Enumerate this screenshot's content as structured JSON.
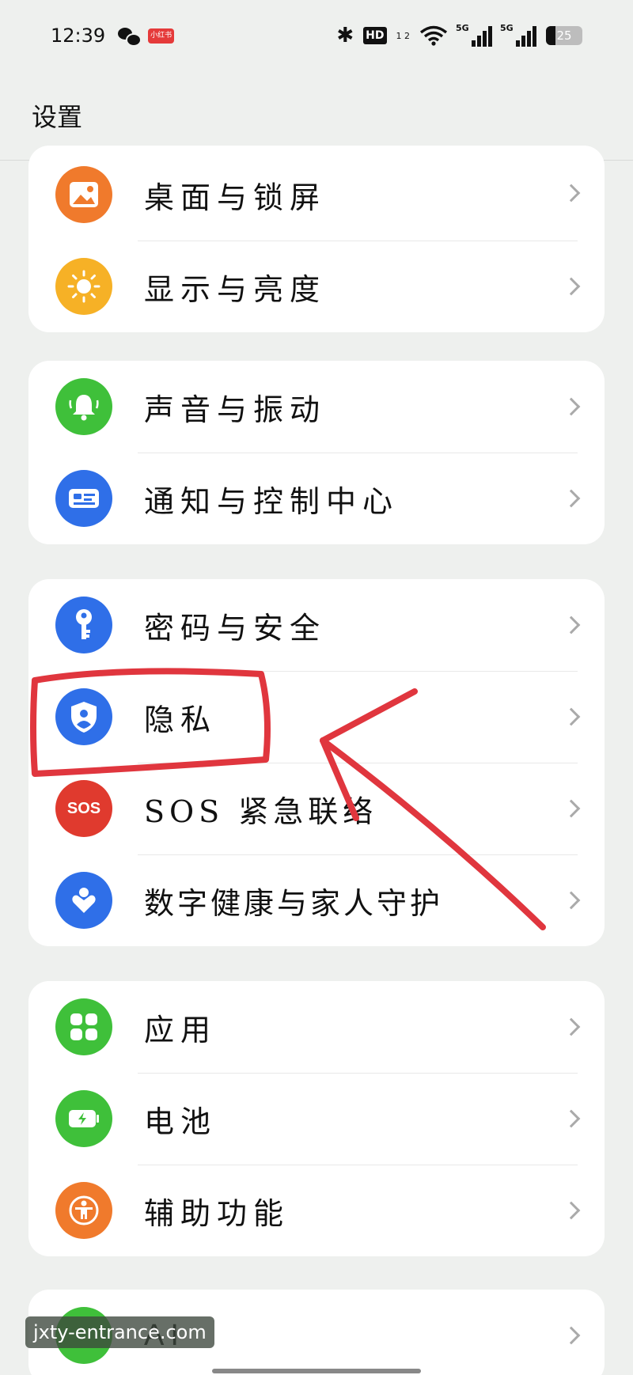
{
  "status_bar": {
    "time": "12:39",
    "xhs_badge": "小红书",
    "hd_badge": "HD",
    "hd_sup": "1 2",
    "signal1_tag": "5G",
    "signal2_tag": "5G",
    "battery_level": "25"
  },
  "header": {
    "title": "设置"
  },
  "cards": [
    {
      "rows": [
        {
          "label": "桌面与锁屏",
          "icon": "wallpaper-icon",
          "color": "#f07a2c"
        },
        {
          "label": "显示与亮度",
          "icon": "sun-icon",
          "color": "#f6b126"
        }
      ]
    },
    {
      "rows": [
        {
          "label": "声音与振动",
          "icon": "bell-icon",
          "color": "#3fc03a"
        },
        {
          "label": "通知与控制中心",
          "icon": "notification-icon",
          "color": "#2f6fe8"
        }
      ]
    },
    {
      "rows": [
        {
          "label": "密码与安全",
          "icon": "key-icon",
          "color": "#2f6fe8"
        },
        {
          "label": "隐私",
          "icon": "privacy-shield-icon",
          "color": "#2f6fe8"
        },
        {
          "label": "SOS 紧急联络",
          "icon": "sos-icon",
          "icon_text": "SOS",
          "color": "#e03a2e"
        },
        {
          "label": "数字健康与家人守护",
          "icon": "heart-person-icon",
          "color": "#2f6fe8"
        }
      ]
    },
    {
      "rows": [
        {
          "label": "应用",
          "icon": "apps-grid-icon",
          "color": "#3fc03a"
        },
        {
          "label": "电池",
          "icon": "battery-charging-icon",
          "color": "#3fc03a"
        },
        {
          "label": "辅助功能",
          "icon": "accessibility-icon",
          "color": "#f07a2c"
        }
      ]
    },
    {
      "rows": [
        {
          "label": "AI",
          "icon": "ai-icon",
          "color": "#3fc03a"
        }
      ]
    }
  ],
  "watermark": "jxty-entrance.com",
  "annotation_color": "#e0363e"
}
